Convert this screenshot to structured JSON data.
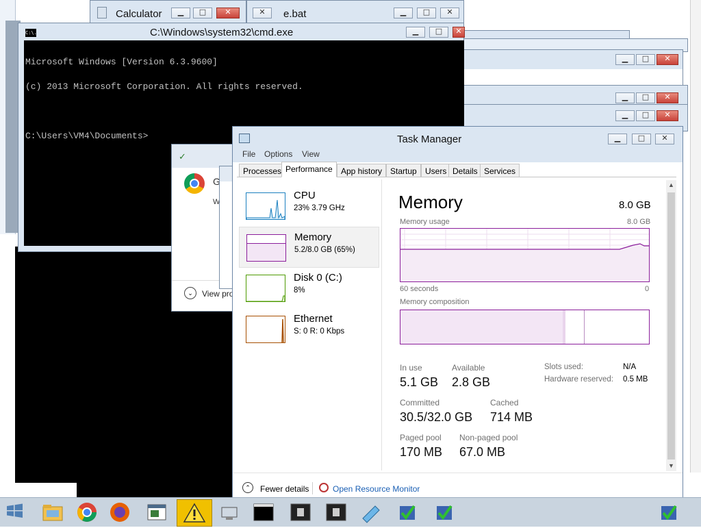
{
  "calculator": {
    "title": "Calculator"
  },
  "bat_window": {
    "title_fragment": "e.bat"
  },
  "cmd": {
    "title": "C:\\Windows\\system32\\cmd.exe",
    "icon_text": "C:\\.",
    "lines": [
      "Microsoft Windows [Version 6.3.9600]",
      "(c) 2013 Microsoft Corporation. All rights reserved.",
      "",
      "C:\\Users\\VM4\\Documents>"
    ]
  },
  "chrome_dialog": {
    "title_fragment": "G",
    "body_fragment": "W",
    "view_label": "View pro"
  },
  "taskmgr": {
    "title": "Task Manager",
    "menu": [
      "File",
      "Options",
      "View"
    ],
    "tabs": [
      "Processes",
      "Performance",
      "App history",
      "Startup",
      "Users",
      "Details",
      "Services"
    ],
    "active_tab": "Performance",
    "sidebar": [
      {
        "name": "CPU",
        "sub": "23%  3.79 GHz",
        "color": "#1a7fbf"
      },
      {
        "name": "Memory",
        "sub": "5.2/8.0 GB (65%)",
        "color": "#8b1e9b"
      },
      {
        "name": "Disk 0 (C:)",
        "sub": "8%",
        "color": "#4d9a00"
      },
      {
        "name": "Ethernet",
        "sub": "S: 0  R: 0 Kbps",
        "color": "#a74f01"
      }
    ],
    "memory": {
      "heading": "Memory",
      "total": "8.0 GB",
      "usage_label": "Memory usage",
      "usage_max": "8.0 GB",
      "time_left": "60 seconds",
      "time_right": "0",
      "composition_label": "Memory composition",
      "in_use_label": "In use",
      "in_use": "5.1 GB",
      "available_label": "Available",
      "available": "2.8 GB",
      "slots_label": "Slots used:",
      "slots": "N/A",
      "hw_reserved_label": "Hardware reserved:",
      "hw_reserved": "0.5 MB",
      "committed_label": "Committed",
      "committed": "30.5/32.0 GB",
      "cached_label": "Cached",
      "cached": "714 MB",
      "paged_label": "Paged pool",
      "paged": "170 MB",
      "nonpaged_label": "Non-paged pool",
      "nonpaged": "67.0 MB",
      "usage_fraction": 0.65
    },
    "footer": {
      "fewer": "Fewer details",
      "resource_monitor": "Open Resource Monitor"
    }
  },
  "taskbar": {
    "icons": [
      "start-icon",
      "file-explorer-icon",
      "chrome-icon",
      "firefox-icon",
      "app-window-icon",
      "warning-icon",
      "network-icon",
      "cmd-icon",
      "app-icon-1",
      "app-icon-2",
      "paint-icon",
      "checklist-icon-1",
      "checklist-icon-2",
      "checklist-icon-3"
    ]
  }
}
